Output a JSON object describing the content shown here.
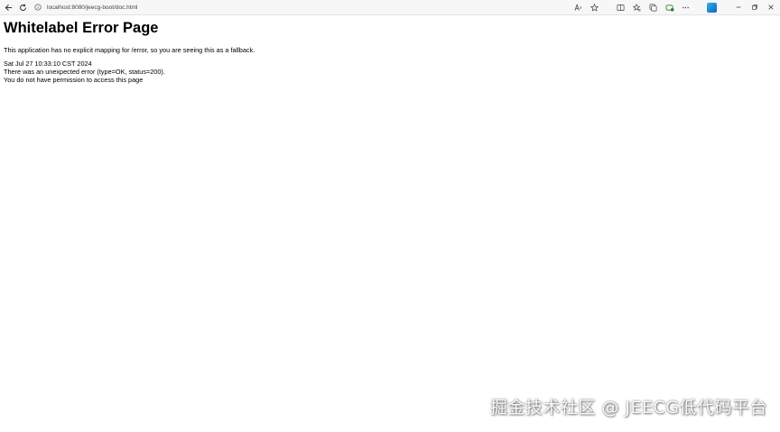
{
  "browser": {
    "url": "localhost:8080/jeecg-boot/doc.html",
    "icons": {
      "back": "back-arrow-icon",
      "refresh": "refresh-icon",
      "site_info": "info-circle-icon",
      "read_aloud": "read-aloud-icon",
      "favorite": "star-icon",
      "split": "split-screen-icon",
      "favorites": "favorites-icon",
      "collections": "collections-icon",
      "extensions": "extension-icon",
      "more": "more-icon",
      "copilot": "copilot-icon",
      "minimize": "minimize-icon",
      "restore": "restore-icon",
      "close": "close-icon"
    }
  },
  "page": {
    "title": "Whitelabel Error Page",
    "message": "This application has no explicit mapping for /error, so you are seeing this as a fallback.",
    "timestamp": "Sat Jul 27 10:33:10 CST 2024",
    "error_line": "There was an unexpected error (type=OK, status=200).",
    "permission_line": "You do not have permission to access this page"
  },
  "watermark": {
    "text": "掘金技术社区 @ JEECG低代码平台"
  }
}
